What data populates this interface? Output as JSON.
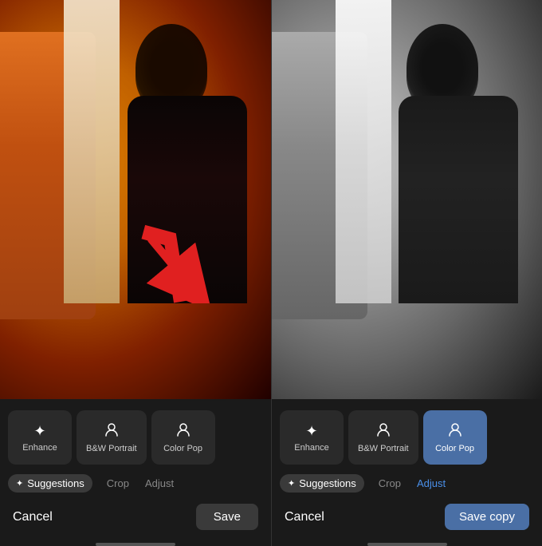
{
  "left_panel": {
    "photo_description": "Warm orange toned photo of man in car",
    "suggestions": [
      {
        "id": "enhance",
        "icon": "✦",
        "label": "Enhance",
        "active": false
      },
      {
        "id": "bw_portrait",
        "icon": "👤",
        "label": "B&W Portrait",
        "active": false
      },
      {
        "id": "color_pop",
        "icon": "👤",
        "label": "Color Pop",
        "active": false
      }
    ],
    "tabs": [
      {
        "id": "suggestions",
        "label": "Suggestions",
        "type": "active"
      },
      {
        "id": "crop",
        "label": "Crop",
        "type": "normal"
      },
      {
        "id": "adjust",
        "label": "Adjust",
        "type": "normal"
      }
    ],
    "cancel_label": "Cancel",
    "save_label": "Save",
    "arrow_visible": true
  },
  "right_panel": {
    "photo_description": "Black and white photo of man in car with Color Pop applied",
    "suggestions": [
      {
        "id": "enhance",
        "icon": "✦",
        "label": "Enhance",
        "active": false
      },
      {
        "id": "bw_portrait",
        "icon": "👤",
        "label": "B&W Portrait",
        "active": false
      },
      {
        "id": "color_pop",
        "icon": "👤",
        "label": "Color Pop",
        "active": true
      }
    ],
    "tabs": [
      {
        "id": "suggestions",
        "label": "Suggestions",
        "type": "active"
      },
      {
        "id": "crop",
        "label": "Crop",
        "type": "normal"
      },
      {
        "id": "adjust",
        "label": "Adjust",
        "type": "blue"
      }
    ],
    "cancel_label": "Cancel",
    "save_label": "Save copy"
  },
  "colors": {
    "active_button": "#4a6fa5",
    "dark_bg": "#1a1a1a",
    "inactive_btn": "#2a2a2a",
    "save_btn": "#3a3a3a",
    "blue_text": "#4a8fe8"
  },
  "icons": {
    "enhance": "✦",
    "portrait": "⊙",
    "sparkle": "✦"
  }
}
